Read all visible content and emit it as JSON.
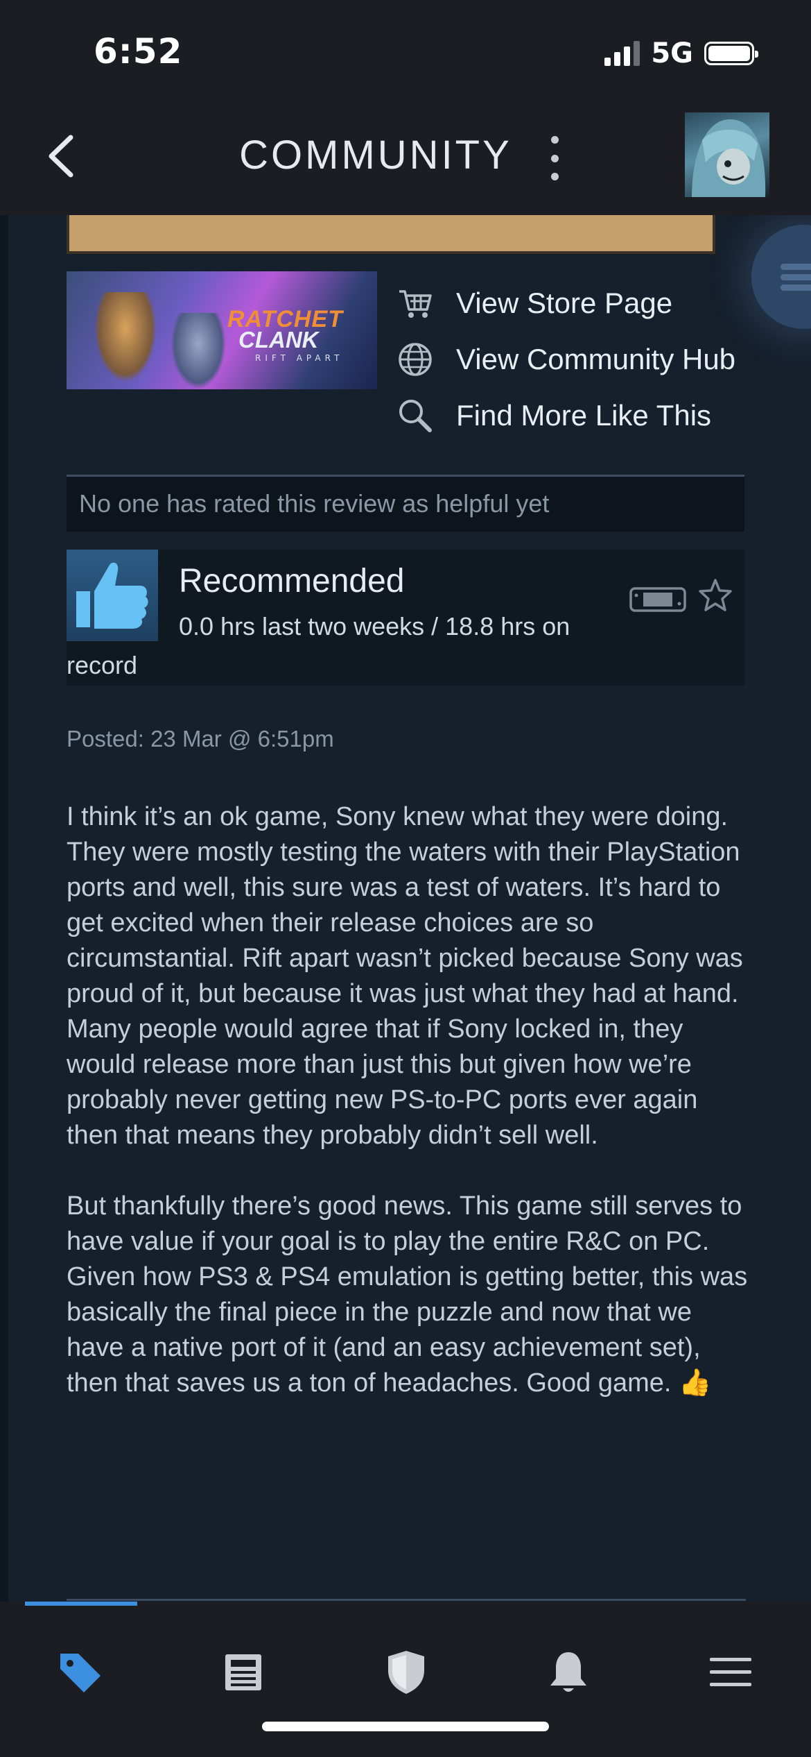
{
  "status_bar": {
    "time": "6:52",
    "network": "5G"
  },
  "header": {
    "title": "COMMUNITY"
  },
  "game_capsule": {
    "line1": "RATCHET",
    "line2": "CLANK",
    "line3": "RIFT APART"
  },
  "links": [
    {
      "label": "View Store Page",
      "icon": "cart-icon"
    },
    {
      "label": "View Community Hub",
      "icon": "globe-icon"
    },
    {
      "label": "Find More Like This",
      "icon": "search-icon"
    }
  ],
  "helpful": {
    "text": "No one has rated this review as helpful yet"
  },
  "recommendation": {
    "title": "Recommended",
    "hours_line1": "0.0 hrs last two weeks / 18.8 hrs on",
    "hours_line2": "record"
  },
  "posted": "Posted: 23 Mar @ 6:51pm",
  "review": {
    "paragraph1": "I think it’s an ok game, Sony knew what they were doing. They were mostly testing the waters with their PlayStation ports and well, this sure was a test of waters. It’s hard to get excited when their release choices are so circumstantial. Rift apart wasn’t picked because Sony was proud of it, but because it was just what they had at hand. Many people would agree that if Sony locked in, they would release more than just this but given how we’re probably never getting new PS-to-PC ports ever again then that means they probably didn’t sell well.",
    "paragraph2": "But thankfully there’s good news. This game still serves to have value if your goal is to play the entire R&C on PC. Given how PS3 & PS4 emulation is getting better, this was basically the final piece in the puzzle and now that we have a native port of it (and an easy achievement set), then that saves us a ton of headaches. Good game.",
    "emoji": "👍"
  },
  "tabbar": {
    "items": [
      "store-tag-icon",
      "news-icon",
      "shield-icon",
      "bell-icon",
      "menu-icon"
    ],
    "active": 0
  },
  "colors": {
    "accent": "#3d8fe0",
    "background": "#16202d",
    "bar": "#1b1d22"
  }
}
